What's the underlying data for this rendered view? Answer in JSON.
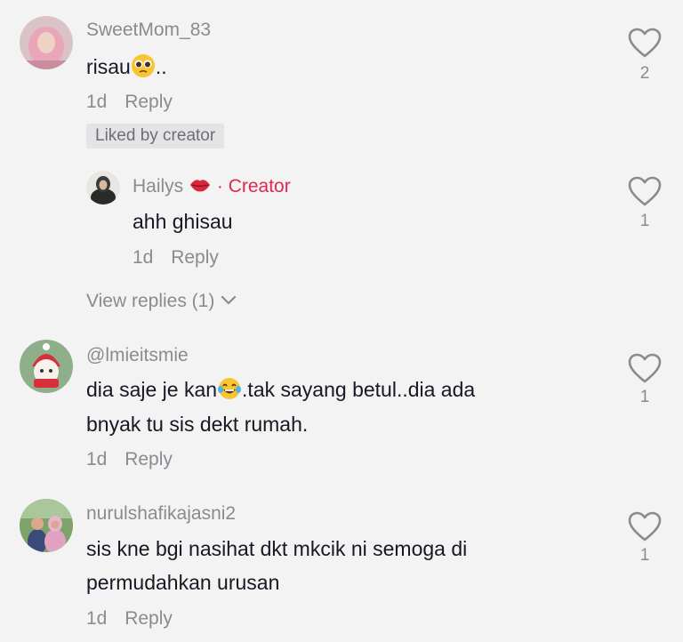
{
  "comments": [
    {
      "username": "SweetMom_83",
      "text_before": "risau",
      "emoji": "pleading-face",
      "text_after": "..",
      "time": "1d",
      "reply_label": "Reply",
      "liked_badge": "Liked by creator",
      "likes": "2",
      "reply": {
        "username": "Hailys",
        "emoji": "kiss-lips",
        "creator_label": "· Creator",
        "text": "ahh ghisau",
        "time": "1d",
        "reply_label": "Reply",
        "likes": "1"
      },
      "view_replies": "View replies (1)"
    },
    {
      "username": "@lmieitsmie",
      "text_line1_before": "dia saje je kan",
      "emoji": "tears-of-joy",
      "text_line1_after": ".tak sayang betul..dia ada",
      "text_line2": "bnyak tu sis dekt rumah.",
      "time": "1d",
      "reply_label": "Reply",
      "likes": "1"
    },
    {
      "username": "nurulshafikajasni2",
      "text_line1": "sis kne bgi nasihat dkt mkcik ni semoga di",
      "text_line2": "permudahkan urusan",
      "time": "1d",
      "reply_label": "Reply",
      "likes": "1"
    }
  ],
  "colors": {
    "background": "#f3f3f3",
    "creator_accent": "#e0284d",
    "muted_text": "#8a8b91"
  }
}
